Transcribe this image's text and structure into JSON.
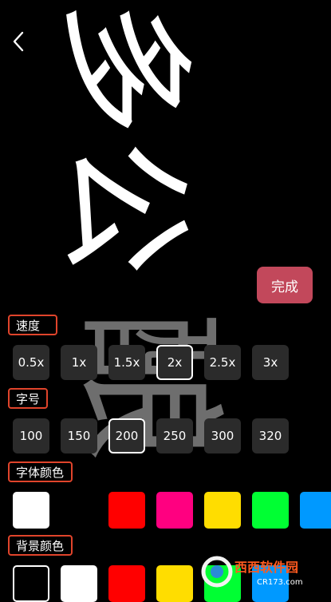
{
  "preview": {
    "white_char_1": "多",
    "white_char_2": "公",
    "gray_char": "酿"
  },
  "done_label": "完成",
  "speed": {
    "label": "速度",
    "options": [
      "0.5x",
      "1x",
      "1.5x",
      "2x",
      "2.5x",
      "3x"
    ],
    "selected": "2x"
  },
  "font_size": {
    "label": "字号",
    "options": [
      "100",
      "150",
      "200",
      "250",
      "300",
      "320"
    ],
    "selected": "200"
  },
  "font_color": {
    "label": "字体颜色",
    "colors": [
      "#ffffff",
      "#ff0000",
      "#ff0080",
      "#ffdd00",
      "#00ff33",
      "#0099ff"
    ]
  },
  "bg_color": {
    "label": "背景颜色",
    "colors": [
      "#000000",
      "#ffffff",
      "#ff0000",
      "#ffdd00",
      "#00ff33",
      "#0099ff"
    ]
  },
  "watermark_text": "西西软件园",
  "watermark_url": "CR173.com"
}
